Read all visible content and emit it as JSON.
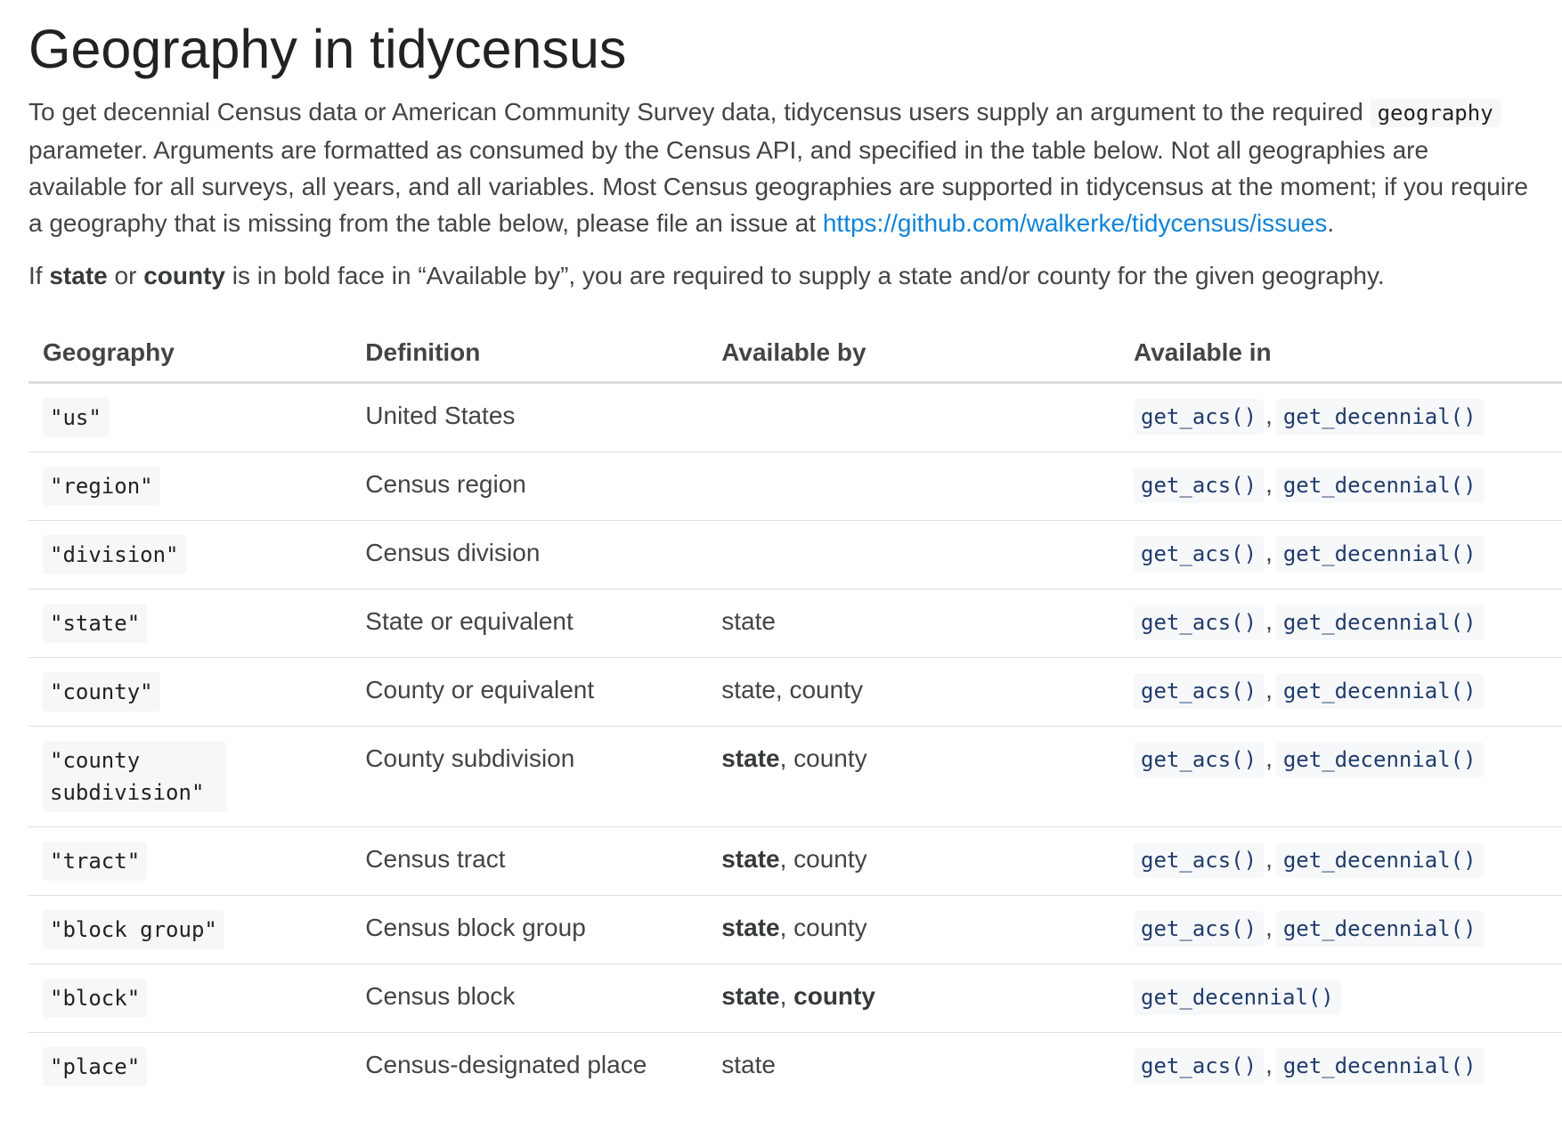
{
  "title": "Geography in tidycensus",
  "intro": {
    "p1_before_code": "To get decennial Census data or American Community Survey data, tidycensus users supply an argument to the required ",
    "p1_code": "geography",
    "p1_after_code": " parameter. Arguments are formatted as consumed by the Census API, and specified in the table below. Not all geographies are available for all surveys, all years, and all variables. Most Census geographies are supported in tidycensus at the moment; if you require a geography that is missing from the table below, please file an issue at ",
    "p1_link": "https://github.com/walkerke/tidycensus/issues",
    "p1_end": ".",
    "p2_start": "If ",
    "p2_bold_state": "state",
    "p2_or": " or ",
    "p2_bold_county": "county",
    "p2_end": " is in bold face in “Available by”, you are required to supply a state and/or county for the given geography."
  },
  "table": {
    "headers": {
      "geography": "Geography",
      "definition": "Definition",
      "available_by": "Available by",
      "available_in": "Available in"
    },
    "rows": [
      {
        "geography": "\"us\"",
        "definition": "United States",
        "by_state": "",
        "by_sep": "",
        "by_county": "",
        "in_1": "get_acs()",
        "in_sep": ",",
        "in_2": "get_decennial()"
      },
      {
        "geography": "\"region\"",
        "definition": "Census region",
        "by_state": "",
        "by_sep": "",
        "by_county": "",
        "in_1": "get_acs()",
        "in_sep": ",",
        "in_2": "get_decennial()"
      },
      {
        "geography": "\"division\"",
        "definition": "Census division",
        "by_state": "",
        "by_sep": "",
        "by_county": "",
        "in_1": "get_acs()",
        "in_sep": ",",
        "in_2": "get_decennial()"
      },
      {
        "geography": "\"state\"",
        "definition": "State or equivalent",
        "by_state": "state",
        "by_sep": "",
        "by_county": "",
        "in_1": "get_acs()",
        "in_sep": ",",
        "in_2": "get_decennial()"
      },
      {
        "geography": "\"county\"",
        "definition": "County or equivalent",
        "by_state": "state",
        "by_sep": ", ",
        "by_county": "county",
        "in_1": "get_acs()",
        "in_sep": ",",
        "in_2": "get_decennial()"
      },
      {
        "geography": "\"county subdivision\"",
        "definition": "County subdivision",
        "by_state": "state",
        "by_sep": ", ",
        "by_county": "county",
        "in_1": "get_acs()",
        "in_sep": ",",
        "in_2": "get_decennial()"
      },
      {
        "geography": "\"tract\"",
        "definition": "Census tract",
        "by_state": "state",
        "by_sep": ", ",
        "by_county": "county",
        "in_1": "get_acs()",
        "in_sep": ",",
        "in_2": "get_decennial()"
      },
      {
        "geography": "\"block group\"",
        "definition": "Census block group",
        "by_state": "state",
        "by_sep": ", ",
        "by_county": "county",
        "in_1": "get_acs()",
        "in_sep": ",",
        "in_2": "get_decennial()"
      },
      {
        "geography": "\"block\"",
        "definition": "Census block",
        "by_state": "state",
        "by_sep": ", ",
        "by_county": "county",
        "in_1": "get_decennial()",
        "in_sep": "",
        "in_2": ""
      },
      {
        "geography": "\"place\"",
        "definition": "Census-designated place",
        "by_state": "state",
        "by_sep": "",
        "by_county": "",
        "in_1": "get_acs()",
        "in_sep": ",",
        "in_2": "get_decennial()"
      }
    ]
  },
  "colors": {
    "link": "#0f84d8",
    "code_fn": "#203c6b",
    "text": "#444444",
    "heading": "#222222"
  }
}
